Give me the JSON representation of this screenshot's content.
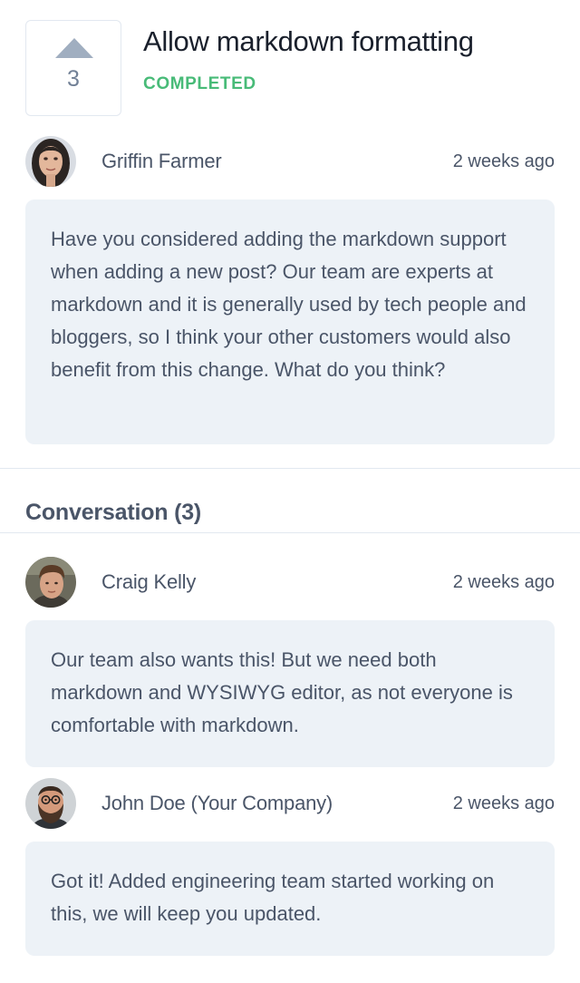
{
  "post": {
    "vote_count": "3",
    "title": "Allow markdown formatting",
    "status": "COMPLETED",
    "status_color": "#48bb78",
    "author": "Griffin Farmer",
    "time": "2 weeks ago",
    "body": "Have you considered adding the markdown support when adding a new post? Our team are experts at markdown and it is generally used by tech people and bloggers, so I think your other customers would also benefit from this change. What do you think?"
  },
  "conversation": {
    "title": "Conversation (3)",
    "comments": [
      {
        "author": "Craig Kelly",
        "time": "2 weeks ago",
        "body": "Our team also wants this! But we need both markdown and WYSIWYG editor, as not everyone is comfortable with markdown."
      },
      {
        "author": "John Doe (Your Company)",
        "time": "2 weeks ago",
        "body": "Got it! Added engineering team started working on this, we will keep you updated."
      }
    ]
  },
  "icons": {
    "upvote": "upvote-triangle-icon"
  }
}
